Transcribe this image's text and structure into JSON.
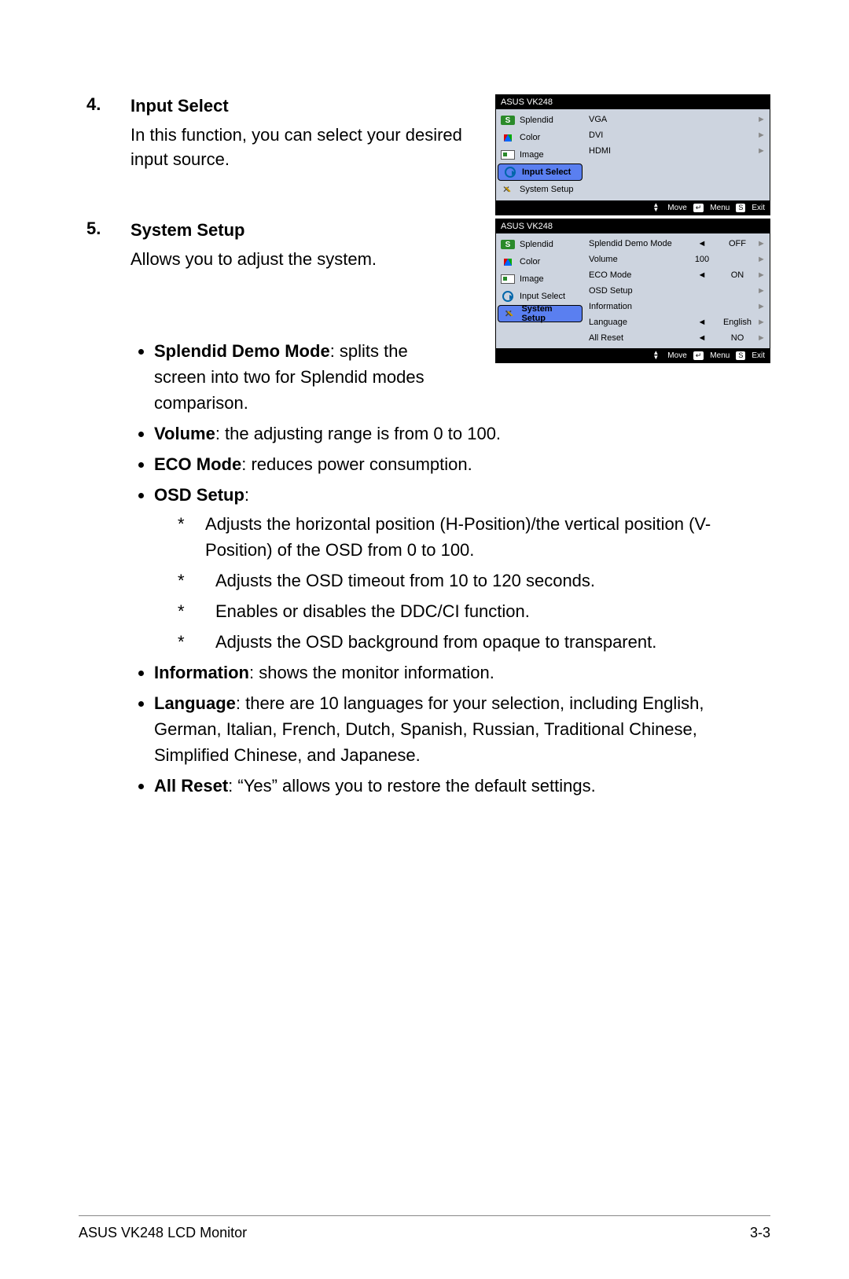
{
  "section4": {
    "num": "4.",
    "title": "Input Select",
    "body": "In this function, you can select your desired input source."
  },
  "section5": {
    "num": "5.",
    "title": "System Setup",
    "body": "Allows you to adjust the system."
  },
  "osd": {
    "header": "ASUS VK248",
    "menu": {
      "splendid": "Splendid",
      "color": "Color",
      "image": "Image",
      "input": "Input Select",
      "setup": "System Setup"
    },
    "inputs": {
      "vga": "VGA",
      "dvi": "DVI",
      "hdmi": "HDMI"
    },
    "setupItems": {
      "demo": {
        "label": "Splendid Demo Mode",
        "val": "OFF"
      },
      "volume": {
        "label": "Volume",
        "val": "100"
      },
      "eco": {
        "label": "ECO Mode",
        "val": "ON"
      },
      "osd": {
        "label": "OSD Setup"
      },
      "info": {
        "label": "Information"
      },
      "lang": {
        "label": "Language",
        "val": "English"
      },
      "reset": {
        "label": "All Reset",
        "val": "NO"
      }
    },
    "footer": {
      "move": "Move",
      "menu": "Menu",
      "exit": "Exit",
      "menuKey": "↵",
      "exitKey": "S"
    }
  },
  "bullets": {
    "splendid": {
      "head": "Splendid Demo Mode",
      "tail": ": splits the screen into two for Splendid modes comparison."
    },
    "volume": {
      "head": "Volume",
      "tail": ": the adjusting range is from 0 to 100."
    },
    "eco": {
      "head": "ECO Mode",
      "tail": ": reduces power consumption."
    },
    "osd": {
      "head": "OSD Setup",
      "tail": ":"
    },
    "osdSubs": {
      "a": "Adjusts the horizontal position (H-Position)/the vertical position (V-Position) of the OSD from 0 to 100.",
      "b": "Adjusts the OSD timeout from 10 to 120 seconds.",
      "c": "Enables or disables the DDC/CI function.",
      "d": "Adjusts the OSD background from opaque to transparent."
    },
    "info": {
      "head": "Information",
      "tail": ": shows the monitor information."
    },
    "lang": {
      "head": "Language",
      "tail": ": there are 10 languages for your selection, including English, German, Italian, French, Dutch, Spanish, Russian, Traditional Chinese, Simplified Chinese, and Japanese."
    },
    "reset": {
      "head": "All Reset",
      "tail": ": “Yes” allows you to restore the default settings."
    }
  },
  "footer": {
    "left": "ASUS VK248 LCD Monitor",
    "right": "3-3"
  },
  "glyphs": {
    "left": "◄",
    "right": "►",
    "star": "*"
  }
}
